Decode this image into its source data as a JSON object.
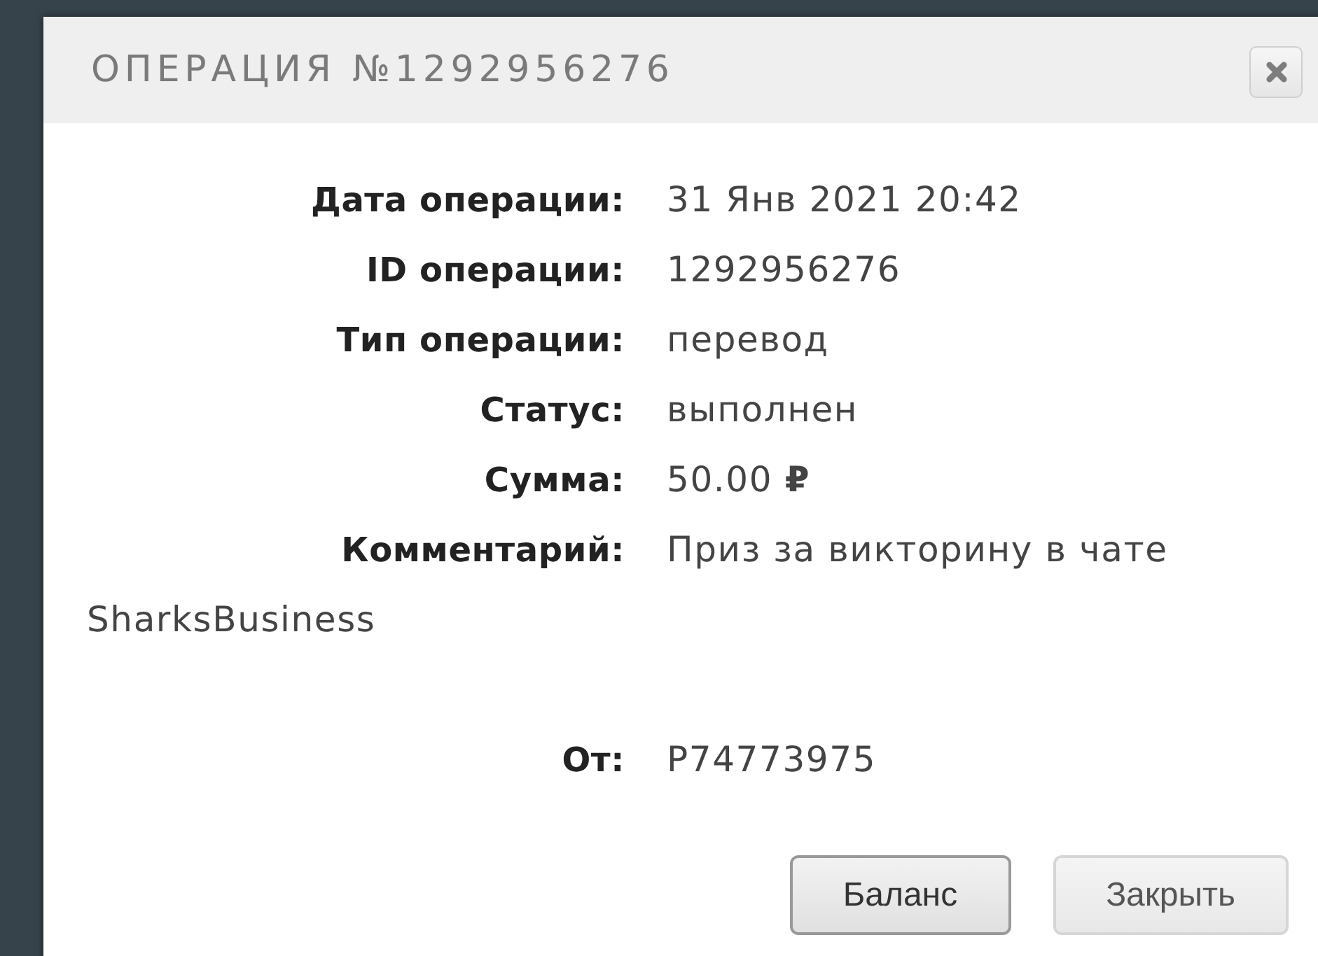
{
  "dialog": {
    "title": "ОПЕРАЦИЯ №1292956276"
  },
  "fields": [
    {
      "label": "Дата операции:",
      "value": "31 Янв 2021 20:42"
    },
    {
      "label": "ID операции:",
      "value": "1292956276"
    },
    {
      "label": "Тип операции:",
      "value": "перевод"
    },
    {
      "label": "Статус:",
      "value": "выполнен"
    },
    {
      "label": "Сумма:",
      "value": "50.00 **₽**"
    }
  ],
  "comment": {
    "label": "Комментарий:",
    "value": "Приз за викторину в чате SharksBusiness"
  },
  "sender": {
    "label": "От:",
    "value": "P74773975"
  },
  "buttons": [
    {
      "label": "Баланс",
      "focused": true
    },
    {
      "label": "Закрыть",
      "focused": false
    }
  ]
}
